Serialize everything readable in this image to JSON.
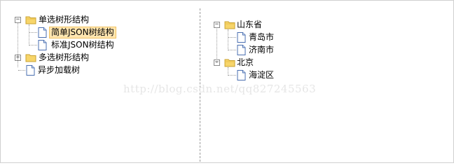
{
  "left_tree": {
    "n0": {
      "label": "单选树形结构",
      "expanded": true
    },
    "n0_0": {
      "label": "简单JSON树结构",
      "selected": true
    },
    "n0_1": {
      "label": "标准JSON树结构"
    },
    "n1": {
      "label": "多选树形结构",
      "expanded": false
    },
    "n2": {
      "label": "异步加载树"
    }
  },
  "right_tree": {
    "n0": {
      "label": "山东省",
      "expanded": true
    },
    "n0_0": {
      "label": "青岛市"
    },
    "n0_1": {
      "label": "济南市"
    },
    "n1": {
      "label": "北京",
      "expanded": true
    },
    "n1_0": {
      "label": "海淀区"
    }
  },
  "icons": {
    "expanded": "minus",
    "collapsed": "plus"
  },
  "colors": {
    "selection_bg": "#ffe6b0",
    "selection_border": "#f2c362",
    "folder": "#f7d56a",
    "watermark": "#e6e6e6"
  },
  "watermark_text": "http://blog.csdn.net/qq827245563"
}
